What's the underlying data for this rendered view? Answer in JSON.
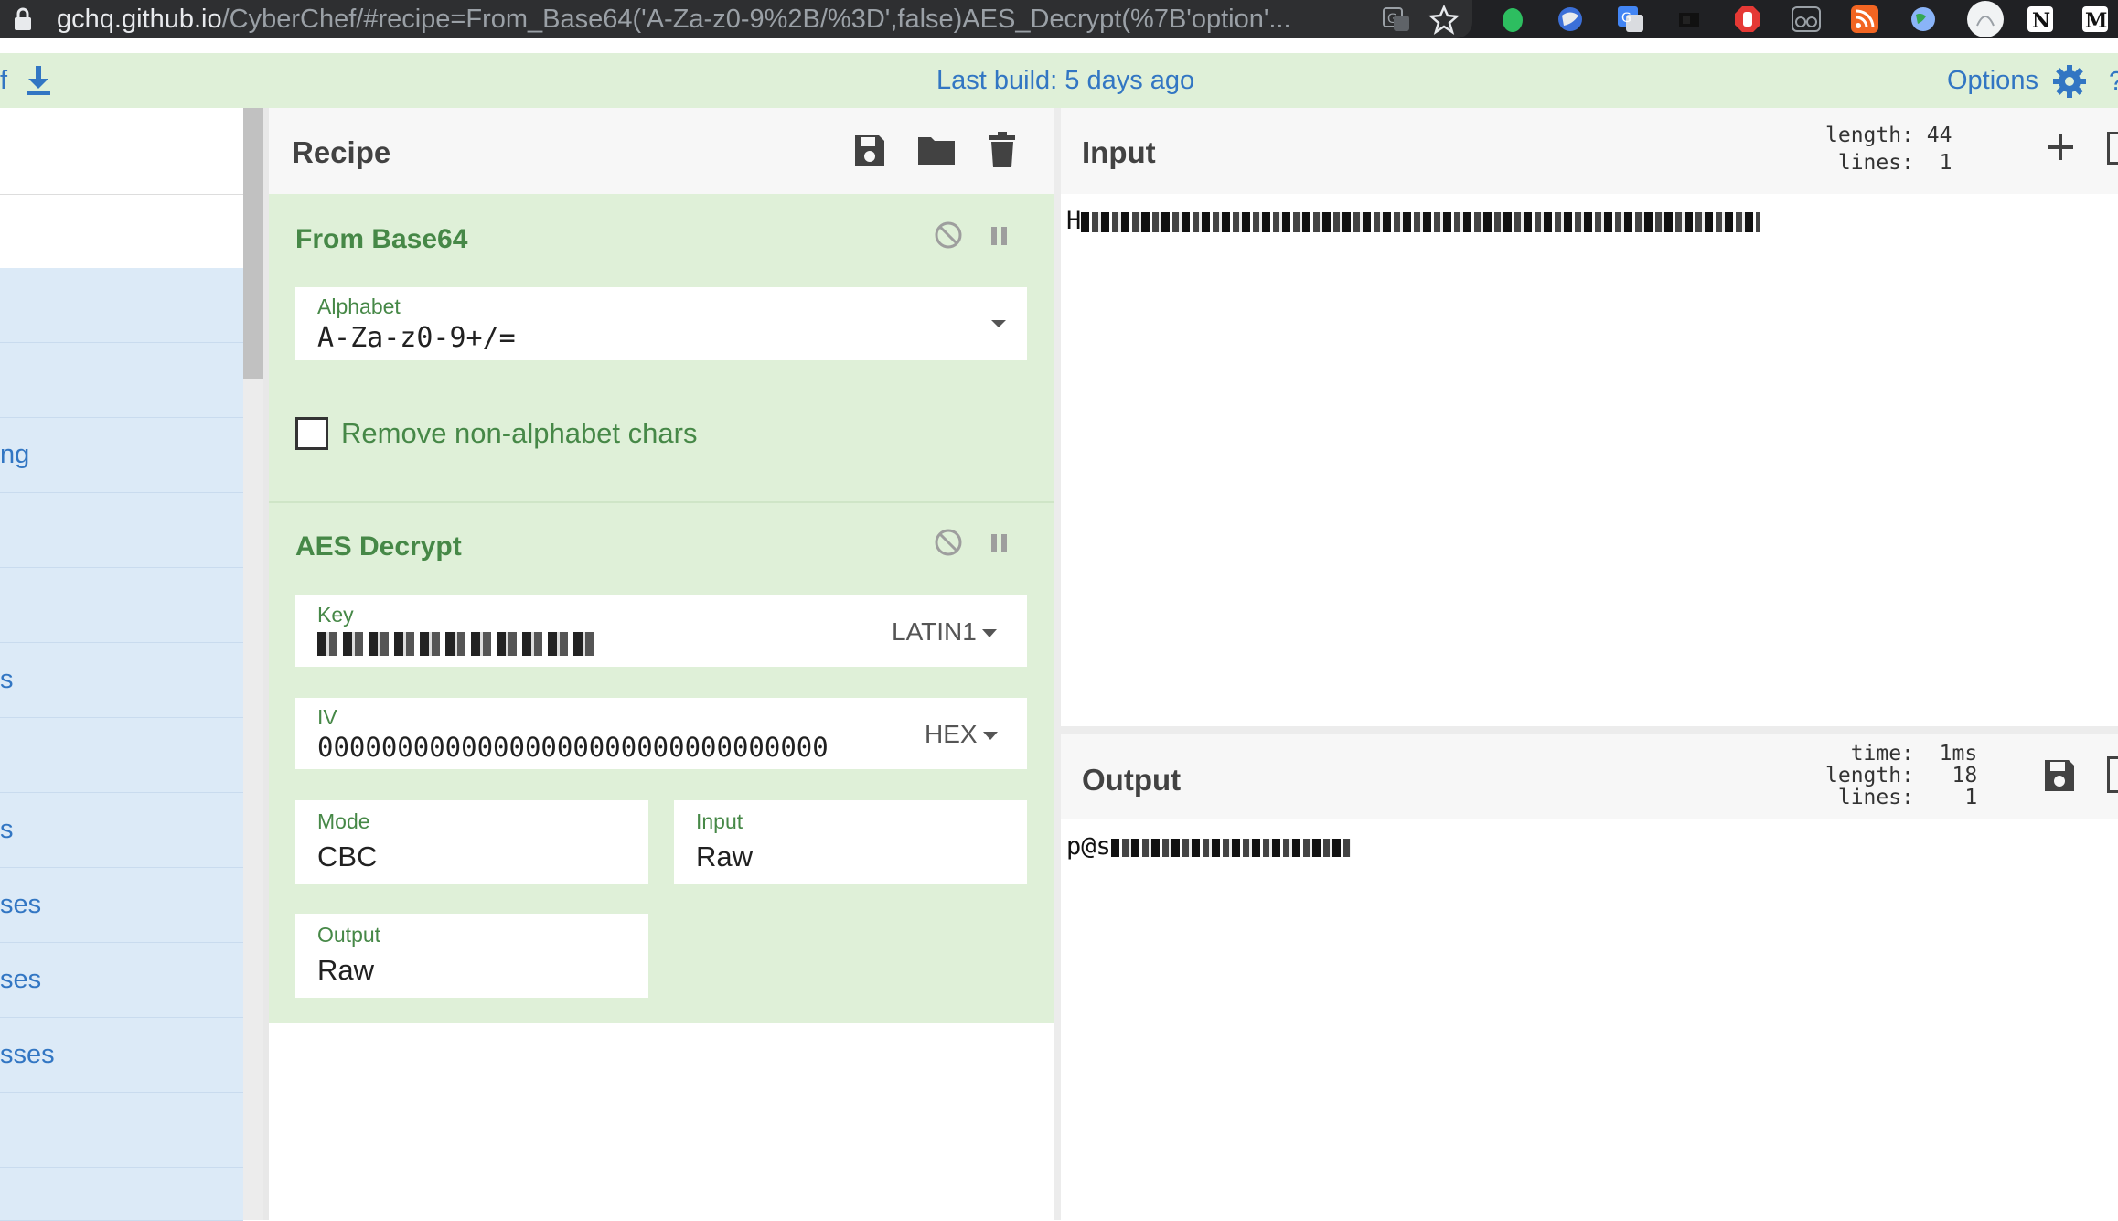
{
  "browser": {
    "url_host": "gchq.github.io",
    "url_rest": "/CyberChef/#recipe=From_Base64('A-Za-z0-9%2B/%3D',false)AES_Decrypt(%7B'option'...",
    "extension_icons": [
      "translate-icon",
      "star-icon",
      "evernote-icon",
      "globe-icon",
      "google-translate-icon",
      "dark-ext-icon",
      "adblock-icon",
      "glasses-icon",
      "rss-icon",
      "world-icon",
      "avatar-icon",
      "notion-icon",
      "gmail-icon"
    ]
  },
  "topbar": {
    "left_fragment": "f",
    "last_build": "Last build: 5 days ago",
    "options_label": "Options"
  },
  "operations": {
    "categories": [
      "",
      "",
      "ng",
      "",
      "",
      "s",
      "",
      "s",
      "ses",
      "ses",
      "sses",
      ""
    ]
  },
  "recipe": {
    "title": "Recipe",
    "from_base64": {
      "name": "From Base64",
      "alphabet_label": "Alphabet",
      "alphabet_value": "A-Za-z0-9+/=",
      "remove_label": "Remove non-alphabet chars"
    },
    "aes_decrypt": {
      "name": "AES Decrypt",
      "key_label": "Key",
      "key_encoding": "LATIN1",
      "iv_label": "IV",
      "iv_value": "00000000000000000000000000000000",
      "iv_encoding": "HEX",
      "mode_label": "Mode",
      "mode_value": "CBC",
      "input_label": "Input",
      "input_value": "Raw",
      "output_label": "Output",
      "output_value": "Raw"
    }
  },
  "input": {
    "title": "Input",
    "length_line": "length: 44",
    "lines_line": " lines:  1",
    "text_prefix": "H"
  },
  "output": {
    "title": "Output",
    "time_line": "  time:  1ms",
    "length_line": "length:   18",
    "lines_line": " lines:    1",
    "text_prefix": "p@s"
  },
  "colors": {
    "accent": "#3276c3",
    "recipe_green": "#468847",
    "recipe_bg": "#dff0d8"
  }
}
